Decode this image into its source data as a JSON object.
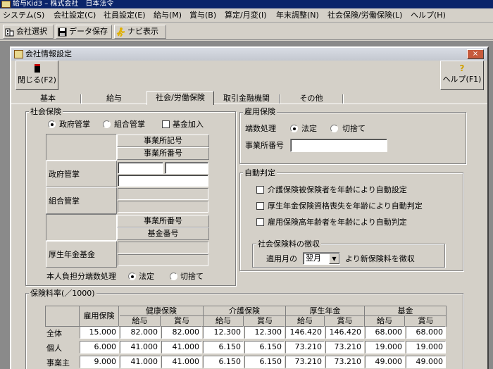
{
  "app": {
    "title": "給与Kid3 – 株式会社　日本法令"
  },
  "menu": [
    "システム(S)",
    "会社設定(C)",
    "社員設定(E)",
    "給与(M)",
    "賞与(B)",
    "算定/月変(I)",
    "年末調整(N)",
    "社会保険/労働保険(L)",
    "ヘルプ(H)"
  ],
  "toolbar": {
    "company": "会社選択",
    "save": "データ保存",
    "navi": "ナビ表示"
  },
  "window": {
    "title": "会社情報設定",
    "close_label": "閉じる(F2)",
    "help_label": "ヘルプ(F1)",
    "close_x": "×"
  },
  "tabs": [
    "基本",
    "給与",
    "社会/労働保険",
    "取引金融機関",
    "その他"
  ],
  "shakai": {
    "title": "社会保険",
    "opt_gov": "政府管掌",
    "opt_union": "組合管掌",
    "fund_check": "基金加入",
    "h_office_code": "事業所記号",
    "h_office_no": "事業所番号",
    "row_gov": "政府管掌",
    "row_union": "組合管掌",
    "h2_office_no": "事業所番号",
    "h2_fund_no": "基金番号",
    "row_pension": "厚生年金基金",
    "rounding_label": "本人負担分端数処理",
    "opt_legal": "法定",
    "opt_cut": "切捨て"
  },
  "koyou": {
    "title": "雇用保険",
    "rounding_label": "端数処理",
    "opt_legal": "法定",
    "opt_cut": "切捨て",
    "office_no_label": "事業所番号"
  },
  "auto": {
    "title": "自動判定",
    "check1": "介護保険被保険者を年齢により自動設定",
    "check2": "厚生年金保険資格喪失を年齢により自動判定",
    "check3": "雇用保険高年齢者を年齢により自動判定"
  },
  "collection": {
    "title": "社会保険料の徴収",
    "prefix": "適用月の",
    "selected": "翌月",
    "suffix": "より新保険料を徴収"
  },
  "rates": {
    "title": "保険料率(／1000)",
    "col_koyou": "雇用保険",
    "groups": [
      "健康保険",
      "介護保険",
      "厚生年金",
      "基金"
    ],
    "sub": [
      "給与",
      "賞与"
    ],
    "rows": [
      {
        "label": "全体",
        "values": [
          "15.000",
          "82.000",
          "82.000",
          "12.300",
          "12.300",
          "146.420",
          "146.420",
          "68.000",
          "68.000"
        ]
      },
      {
        "label": "個人",
        "values": [
          "6.000",
          "41.000",
          "41.000",
          "6.150",
          "6.150",
          "73.210",
          "73.210",
          "19.000",
          "19.000"
        ]
      },
      {
        "label": "事業主",
        "values": [
          "9.000",
          "41.000",
          "41.000",
          "6.150",
          "6.150",
          "73.210",
          "73.210",
          "49.000",
          "49.000"
        ]
      }
    ]
  }
}
